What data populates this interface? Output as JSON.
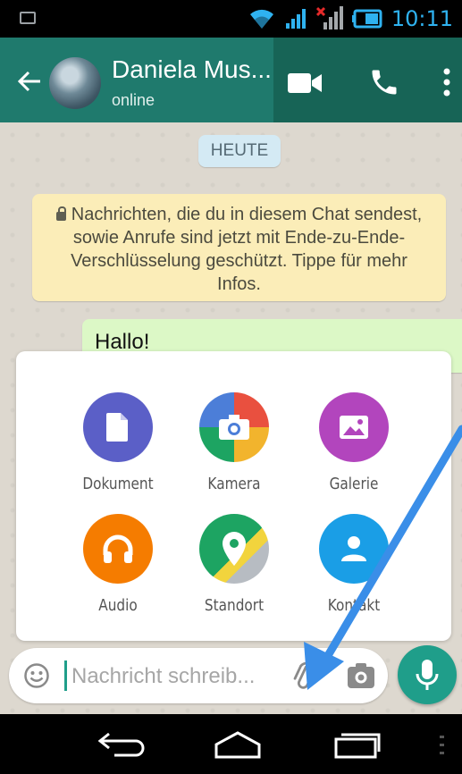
{
  "status_bar": {
    "time": "10:11",
    "icons": [
      "image-icon",
      "wifi-icon",
      "signal-icon",
      "signal-no-sim-icon",
      "battery-icon"
    ]
  },
  "header": {
    "contact_name": "Daniela Mus...",
    "contact_status": "online",
    "actions": [
      "video-call-icon",
      "phone-icon",
      "more-vert-icon"
    ]
  },
  "chat": {
    "date_chip": "HEUTE",
    "encryption_notice": "Nachrichten, die du in diesem Chat sendest, sowie Anrufe sind jetzt mit Ende-zu-Ende-Verschlüsselung geschützt. Tippe für mehr Infos.",
    "messages": [
      {
        "text": "Hallo!",
        "direction": "outgoing"
      }
    ]
  },
  "attach_menu": {
    "items": [
      {
        "label": "Dokument",
        "icon": "document-icon",
        "color": "#5b5fc7"
      },
      {
        "label": "Kamera",
        "icon": "camera-icon",
        "color": "#e9503f"
      },
      {
        "label": "Galerie",
        "icon": "gallery-icon",
        "color": "#b245bd"
      },
      {
        "label": "Audio",
        "icon": "headphones-icon",
        "color": "#f57c00"
      },
      {
        "label": "Standort",
        "icon": "location-icon",
        "color": "#1da462"
      },
      {
        "label": "Kontakt",
        "icon": "contact-icon",
        "color": "#1a9ee6"
      }
    ]
  },
  "composer": {
    "placeholder": "Nachricht schreib...",
    "value": "",
    "icons": [
      "emoji-icon",
      "paperclip-icon",
      "camera-icon",
      "microphone-icon"
    ]
  },
  "colors": {
    "header": "#1f7a6d",
    "accent": "#1f9e8a",
    "outgoing_bubble": "#dcf8c6",
    "notice": "#fbedb8",
    "annotation_arrow": "#3a8ee8"
  },
  "navigation": [
    "back-icon",
    "home-icon",
    "recents-icon"
  ]
}
